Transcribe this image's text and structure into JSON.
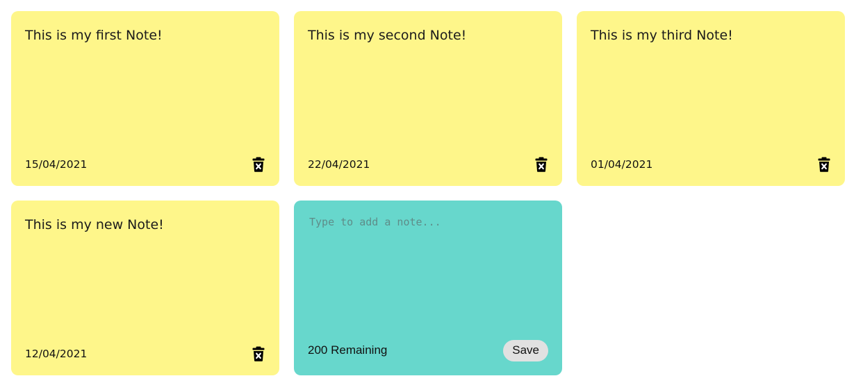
{
  "notes": [
    {
      "text": "This is my first Note!",
      "date": "15/04/2021"
    },
    {
      "text": "This is my second Note!",
      "date": "22/04/2021"
    },
    {
      "text": "This is my third Note!",
      "date": "01/04/2021"
    },
    {
      "text": "This is my new Note!",
      "date": "12/04/2021"
    }
  ],
  "add_note": {
    "placeholder": "Type to add a note...",
    "value": "",
    "remaining_label": "200 Remaining",
    "save_label": "Save"
  },
  "colors": {
    "note_background": "#fef68a",
    "new_note_background": "#67d7cc",
    "save_button_background": "#e1e1e1"
  },
  "icons": {
    "delete": "trash-x-icon"
  }
}
